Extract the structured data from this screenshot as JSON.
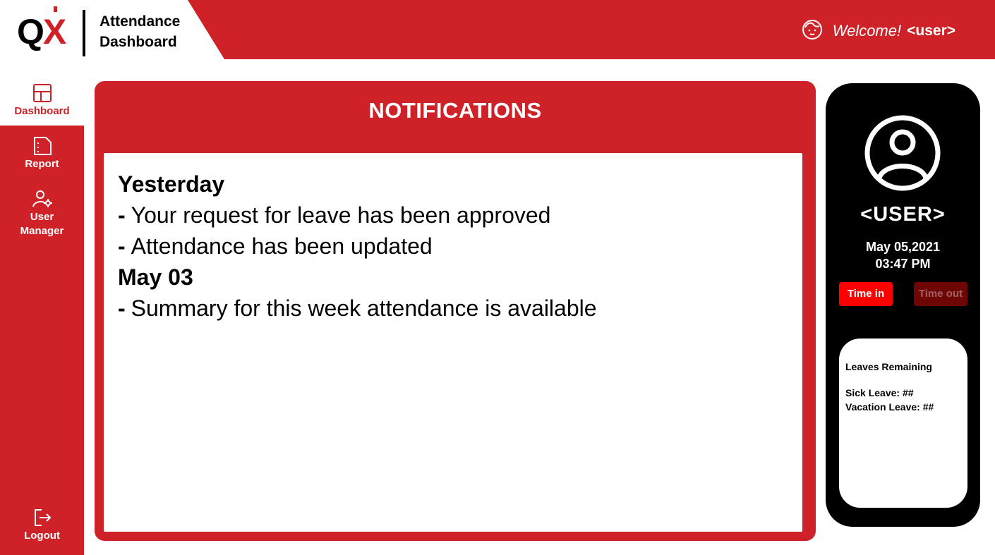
{
  "header": {
    "logo_q": "Q",
    "logo_x": "X",
    "title": "Attendance Dashboard",
    "welcome_text": "Welcome!",
    "username": "<user>",
    "user_icon": "face-icon"
  },
  "sidebar": {
    "items": [
      {
        "label": "Dashboard",
        "icon": "layout-icon",
        "active": true
      },
      {
        "label": "Report",
        "icon": "document-icon",
        "active": false
      },
      {
        "label": "User Manager",
        "icon": "user-gear-icon",
        "active": false
      },
      {
        "label": "Logout",
        "icon": "logout-icon",
        "active": false
      }
    ]
  },
  "notifications": {
    "title": "NOTIFICATIONS",
    "groups": [
      {
        "heading": "Yesterday",
        "items": [
          "Your request for leave has been approved",
          "Attendance has been updated"
        ]
      },
      {
        "heading": "May 03",
        "items": [
          "Summary for this week attendance is available"
        ]
      }
    ],
    "bullet": "-"
  },
  "profile": {
    "username": "<USER>",
    "date": "May 05,2021",
    "time": "03:47 PM",
    "time_in_label": "Time in",
    "time_out_label": "Time out",
    "leaves": {
      "title": "Leaves Remaining",
      "sick": "Sick Leave: ##",
      "vacation": "Vacation Leave: ##"
    }
  },
  "colors": {
    "brand_red": "#cf2128",
    "time_in": "#ff0000",
    "time_out_disabled": "#6e0606",
    "profile_bg": "#000000"
  }
}
